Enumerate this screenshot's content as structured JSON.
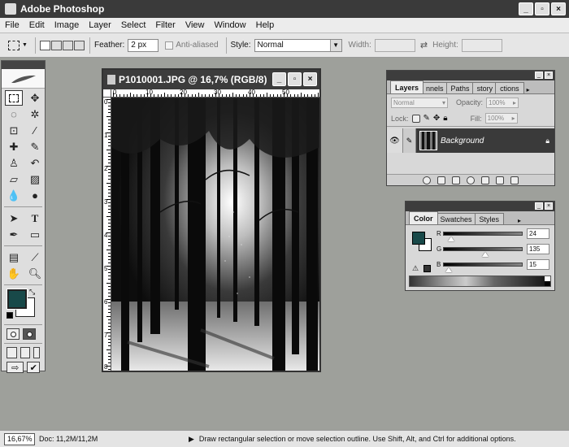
{
  "window": {
    "title": "Adobe Photoshop",
    "buttons": [
      "_",
      "▫",
      "×"
    ]
  },
  "menu": [
    "File",
    "Edit",
    "Image",
    "Layer",
    "Select",
    "Filter",
    "View",
    "Window",
    "Help"
  ],
  "options": {
    "feather_label": "Feather:",
    "feather_value": "2 px",
    "anti_aliased_label": "Anti-aliased",
    "style_label": "Style:",
    "style_value": "Normal",
    "width_label": "Width:",
    "height_label": "Height:"
  },
  "document": {
    "title": "P1010001.JPG @ 16,7% (RGB/8)",
    "ruler_h": [
      "0",
      "10",
      "20",
      "30",
      "40",
      "50"
    ],
    "ruler_v": [
      "0",
      "1",
      "2",
      "3",
      "4",
      "5",
      "6",
      "7",
      "8"
    ]
  },
  "layers_panel": {
    "tabs": [
      "Layers",
      "nnels",
      "Paths",
      "story",
      "ctions"
    ],
    "blend_mode": "Normal",
    "opacity_label": "Opacity:",
    "opacity_value": "100%",
    "lock_label": "Lock:",
    "fill_label": "Fill:",
    "fill_value": "100%",
    "layers": [
      {
        "name": "Background",
        "visible": true,
        "locked": true
      }
    ]
  },
  "color_panel": {
    "tabs": [
      "Color",
      "Swatches",
      "Styles"
    ],
    "channels": [
      {
        "label": "R",
        "value": "24",
        "level": 0.094
      },
      {
        "label": "G",
        "value": "135",
        "level": 0.529
      },
      {
        "label": "B",
        "value": "15",
        "level": 0.059
      }
    ],
    "foreground_color": "#184F0F"
  },
  "status": {
    "zoom": "16,67%",
    "doc": "Doc: 11,2M/11,2M",
    "hint": "Draw rectangular selection or move selection outline. Use Shift, Alt, and Ctrl for additional options."
  }
}
